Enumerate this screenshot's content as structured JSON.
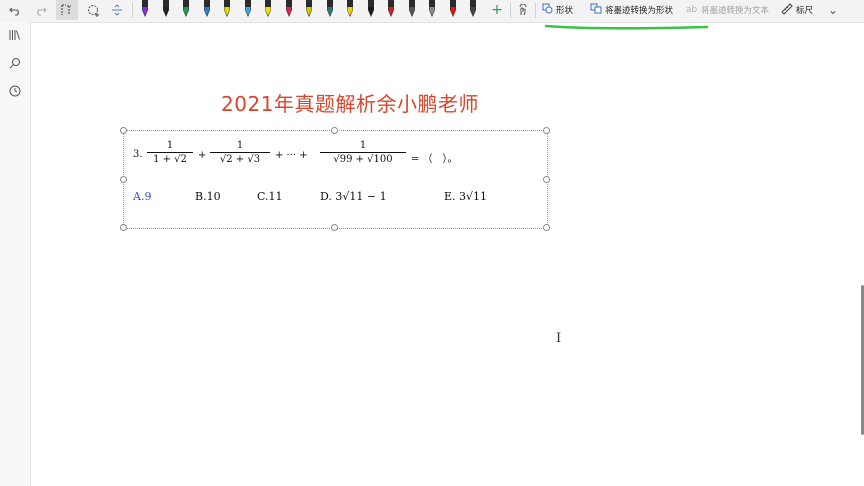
{
  "toolbar": {
    "tools": [
      {
        "name": "undo-icon",
        "glyph": "↶"
      },
      {
        "name": "redo-icon",
        "glyph": "↷"
      },
      {
        "name": "lasso-select-icon",
        "glyph": "⬚"
      },
      {
        "name": "shape-add-icon",
        "glyph": "◌"
      },
      {
        "name": "insert-space-icon",
        "glyph": "÷"
      }
    ],
    "pen_colors": [
      "#8a2be2",
      "#222222",
      "#1f9a4a",
      "#2b7bd6",
      "#e5d400",
      "#3aa7d8",
      "#f5e000",
      "#e02050",
      "#c8c800",
      "#2a7b7b",
      "#f0d000",
      "#1a1a1a",
      "#d02020",
      "#555555",
      "#888888",
      "#e01818",
      "#444444"
    ],
    "add_pen": "+",
    "touch_draw_icon": "☝",
    "shape_label": "形状",
    "ink_to_shape_label": "将墨迹转换为形状",
    "ink_to_text_label": "将墨迹转换为文本",
    "ruler_label": "标尺",
    "more_icon": "⌄"
  },
  "sidebar": {
    "icons": [
      "notebooks-icon",
      "search-icon",
      "recent-icon"
    ]
  },
  "page": {
    "title": "2021年真题解析余小鹏老师"
  },
  "problem": {
    "number": "3.",
    "term1_num": "1",
    "term1_den": "1 + √2",
    "term2_num": "1",
    "term2_den": "√2 + √3",
    "ellipsis": "+ ··· +",
    "term3_num": "1",
    "term3_den": "√99 + √100",
    "equals": "= （　）。",
    "options": {
      "a": "A.9",
      "b": "B.10",
      "c": "C.11",
      "d": "D. 3√11 − 1",
      "e": "E. 3√11"
    }
  }
}
